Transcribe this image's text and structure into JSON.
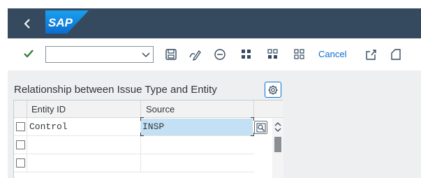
{
  "shell": {
    "back_icon": "chevron-left-icon",
    "logo_text": "SAP",
    "bg_color": "#354a5f"
  },
  "toolbar": {
    "command_field": {
      "value": "",
      "placeholder": ""
    },
    "icons": [
      "checkmark-icon",
      "chevron-down-icon",
      "save-icon",
      "display-change-icon",
      "remove-icon",
      "select-all-icon",
      "select-block-icon",
      "deselect-all-icon",
      "export-icon",
      "import-icon"
    ],
    "cancel_label": "Cancel",
    "accent_color": "#0a6ed1"
  },
  "section": {
    "title": "Relationship between Issue Type and Entity",
    "settings_icon": "settings-gear-icon"
  },
  "table": {
    "columns": [
      "Entity ID",
      "Source"
    ],
    "rows": [
      {
        "entity_id": "Control",
        "source": "INSP",
        "selected": false
      },
      {
        "entity_id": "",
        "source": "",
        "selected": false
      },
      {
        "entity_id": "",
        "source": "",
        "selected": false
      }
    ],
    "value_help_icon": "value-help-icon",
    "scroll_up_icon": "chevron-up-icon"
  }
}
